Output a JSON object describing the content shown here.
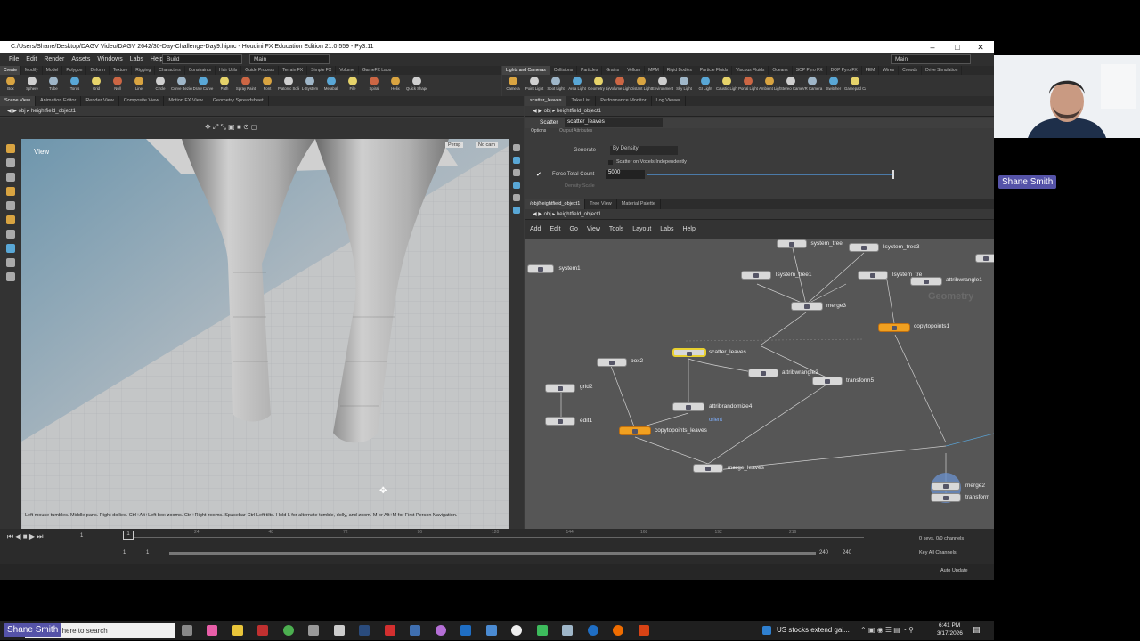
{
  "window": {
    "title": "C:/Users/Shane/Desktop/DAGV Video/DAGV 2642/30-Day-Challenge-Day9.hipnc - Houdini FX Education Edition 21.0.559 - Py3.11",
    "minimize": "–",
    "maximize": "□",
    "close": "✕"
  },
  "menu": [
    "File",
    "Edit",
    "Render",
    "Assets",
    "Windows",
    "Labs",
    "Help"
  ],
  "desktop_build": "Build",
  "desktop_main": "Main",
  "desktop_main_right": "Main",
  "shelf_tabs_left": [
    "Create",
    "Modify",
    "Model",
    "Polygon",
    "Deform",
    "Texture",
    "Rigging",
    "Characters",
    "Constraints",
    "Hair Utils",
    "Guide Process",
    "Terrain FX",
    "Simple FX",
    "Volume",
    "GameFX Labs"
  ],
  "shelf_tabs_right": [
    "Lights and Cameras",
    "Collisions",
    "Particles",
    "Grains",
    "Vellum",
    "MPM",
    "Rigid Bodies",
    "Particle Fluids",
    "Viscous Fluids",
    "Oceans",
    "SOP Pyro FX",
    "DOP Pyro FX",
    "FEM",
    "Wires",
    "Crowds",
    "Drive Simulation"
  ],
  "shelf_tools_left": [
    "Box",
    "Sphere",
    "Tube",
    "Torus",
    "Grid",
    "Null",
    "Line",
    "Circle",
    "Curve Bezier",
    "Draw Curve",
    "Path",
    "Spray Paint",
    "Font",
    "Platonic Solids",
    "L-System",
    "Metaball",
    "File",
    "Spiral",
    "Helix",
    "Quick Shapes"
  ],
  "shelf_tools_right": [
    "Camera",
    "Point Light",
    "Spot Light",
    "Area Light",
    "Geometry Light",
    "Volume Light",
    "Distant Light",
    "Environment Light",
    "Sky Light",
    "GI Light",
    "Caustic Light",
    "Portal Light",
    "Ambient Light",
    "Stereo Camera",
    "VR Camera",
    "Switcher",
    "Gamepad Camera"
  ],
  "left_pane_tabs": [
    "Scene View",
    "Animation Editor",
    "Render View",
    "Composite View",
    "Motion FX View",
    "Geometry Spreadsheet"
  ],
  "left_path": {
    "obj": "obj",
    "node": "heightfield_object1"
  },
  "viewport": {
    "label": "View",
    "persp": "Persp",
    "cam": "No cam",
    "hint": "Left mouse tumbles. Middle pans. Right dollies. Ctrl+Alt+Left box-zooms. Ctrl+Right zooms. Spacebar-Ctrl-Left tilts. Hold L for alternate tumble, dolly, and zoom. M or Alt+M for First Person Navigation."
  },
  "param_pane_tabs": [
    "scatter_leaves",
    "Take List",
    "Performance Monitor",
    "Log Viewer"
  ],
  "param_path": {
    "obj": "obj",
    "node": "heightfield_object1"
  },
  "params": {
    "node_type": "Scatter",
    "node_name": "scatter_leaves",
    "tabs": [
      "Options",
      "Output Attributes"
    ],
    "generate_label": "Generate",
    "generate_value": "By Density",
    "voxels_label": "Scatter on Voxels Independently",
    "force_label": "Force Total Count",
    "force_value": "5000",
    "density_label": "Density Scale"
  },
  "net_pane_tabs": [
    "/obj/heightfield_object1",
    "Tree View",
    "Material Palette"
  ],
  "net_path": {
    "obj": "obj",
    "node": "heightfield_object1"
  },
  "net_menu": [
    "Add",
    "Edit",
    "Go",
    "View",
    "Tools",
    "Layout",
    "Labs",
    "Help"
  ],
  "net_watermark": "Geometry",
  "nodes": {
    "lsystem1": "lsystem1",
    "lsystem_tree": "lsystem_tree",
    "lsystem_tree3": "lsystem_tree3",
    "lsystem_tree1": "lsystem_tree1",
    "lsystem_tree2": "lsystem_tre",
    "attribwrangle1": "attribwrangle1",
    "merge3": "merge3",
    "copytopoints1": "copytopoints1",
    "box2": "box2",
    "scatter_leaves": "scatter_leaves",
    "attribwrangle2": "attribwrangle2",
    "transform5": "transform5",
    "grid2": "grid2",
    "attribrandomize4": "attribrandomize4",
    "orient": "orient",
    "edit1": "edit1",
    "copytopoints_leaves": "copytopoints_leaves",
    "merge_leaves": "merge_leaves",
    "merge2": "merge2",
    "transform": "transform"
  },
  "timeline": {
    "frame": "1",
    "start": "1",
    "start2": "1",
    "end": "240",
    "end2": "240",
    "ticks": [
      "24",
      "48",
      "72",
      "96",
      "120",
      "144",
      "168",
      "192",
      "216"
    ],
    "keys": "0 keys, 0/0 channels",
    "key_all": "Key All Channels",
    "auto_update": "Auto Update"
  },
  "taskbar": {
    "search_placeholder": "Type here to search",
    "news": "US stocks extend gai...",
    "time": "6:41 PM",
    "date": "3/17/2026"
  },
  "webcam": {
    "name": "Shane Smith"
  },
  "bottom_label": "Shane Smith"
}
